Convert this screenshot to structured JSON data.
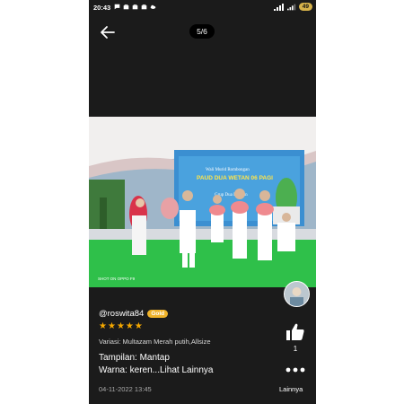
{
  "status_bar": {
    "time": "20:43",
    "icons": [
      "chat-bubble-icon",
      "bag-icon",
      "bag-icon",
      "bag-icon",
      "cloud-icon"
    ],
    "battery": "49"
  },
  "viewer": {
    "counter": "5/6",
    "photo": {
      "banner_lines": [
        "Wali Murid Rombongan",
        "PAUD DUA WETAN 06 PAGI",
        "Grup Dua Kwetan"
      ],
      "watermark": "SHOT ON OPPO F9"
    }
  },
  "review": {
    "username": "@roswita84",
    "badge": "Gold",
    "rating": 5,
    "variant": "Variasi: Multazam Merah putih,Allsize",
    "lines": [
      "Tampilan: Mantap",
      "Warna: keren...Lihat Lainnya"
    ],
    "date": "04-11-2022 13:45"
  },
  "actions": {
    "like_count": "1",
    "more_label": "Lainnya"
  },
  "colors": {
    "background": "#1b1b1b",
    "gold_badge": "#f0b32a",
    "star": "#f5a800",
    "battery": "#d6b24a"
  }
}
